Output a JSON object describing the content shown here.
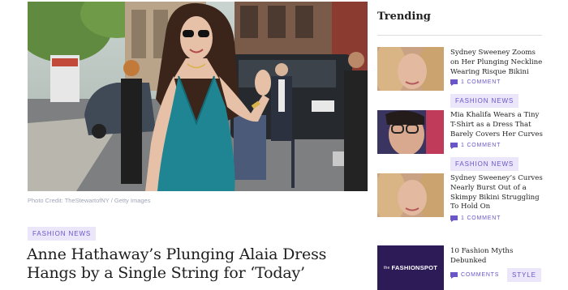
{
  "hero": {
    "alt": "Anne Hathaway in a teal halter dress waving on a city street",
    "credit": "Photo Credit: TheStewartofNY / Getty Images"
  },
  "article": {
    "category": "Fashion News",
    "headline": "Anne Hathaway’s Plunging Alaia Dress Hangs by a Single String for ‘Today’"
  },
  "sidebar": {
    "title": "Trending",
    "items": [
      {
        "title": "Sydney Sweeney Zooms on Her Plunging Neckline Wearing Risque Bikini",
        "comments": "1 Comment",
        "category": "Fashion News"
      },
      {
        "title": "Mia Khalifa Wears a Tiny T-Shirt as a Dress That Barely Covers Her Curves",
        "comments": "1 Comment",
        "category": "Fashion News"
      },
      {
        "title": "Sydney Sweeney’s Curves Nearly Burst Out of a Skimpy Bikini Struggling To Hold On",
        "comments": "1 Comment",
        "category": ""
      },
      {
        "title": "10 Fashion Myths Debunked",
        "comments": "Comments",
        "category": "Style"
      }
    ],
    "logo_text_pre": "the",
    "logo_text_main": "FASHIONSPOT"
  },
  "colors": {
    "accent": "#6a55c9",
    "tag_bg": "#ebe6fa",
    "logo_bg": "#2d1b57"
  },
  "icons": [
    "comment-icon"
  ]
}
